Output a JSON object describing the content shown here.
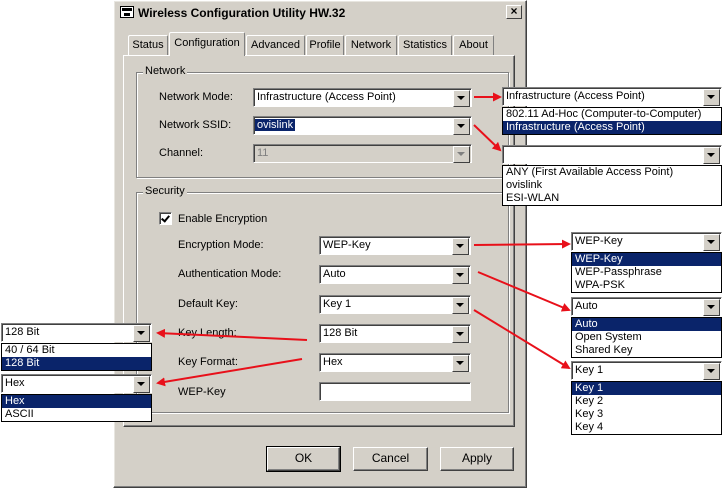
{
  "window": {
    "title": "Wireless Configuration Utility HW.32",
    "close": "×"
  },
  "tabs": [
    {
      "label": "Status"
    },
    {
      "label": "Configuration"
    },
    {
      "label": "Advanced"
    },
    {
      "label": "Profile"
    },
    {
      "label": "Network"
    },
    {
      "label": "Statistics"
    },
    {
      "label": "About"
    }
  ],
  "network_group": {
    "title": "Network",
    "mode_label": "Network Mode:",
    "mode_value": "Infrastructure (Access Point)",
    "ssid_label": "Network SSID:",
    "ssid_value": "ovislink",
    "channel_label": "Channel:",
    "channel_value": "11"
  },
  "security_group": {
    "title": "Security",
    "enable_label": "Enable Encryption",
    "enable_checked": true,
    "enc_mode_label": "Encryption Mode:",
    "enc_mode_value": "WEP-Key",
    "auth_mode_label": "Authentication Mode:",
    "auth_mode_value": "Auto",
    "default_key_label": "Default Key:",
    "default_key_value": "Key 1",
    "key_length_label": "Key Length:",
    "key_length_value": "128 Bit",
    "key_format_label": "Key Format:",
    "key_format_value": "Hex",
    "wep_key_label": "WEP-Key",
    "wep_key_value": ""
  },
  "buttons": {
    "ok": "OK",
    "cancel": "Cancel",
    "apply": "Apply"
  },
  "callouts": {
    "network_mode": {
      "current": "Infrastructure (Access Point)",
      "options": [
        "802.11 Ad-Hoc (Computer-to-Computer)",
        "Infrastructure (Access Point)"
      ],
      "selected": 1
    },
    "ssid": {
      "current": "",
      "options": [
        "ANY (First Available Access Point)",
        "ovislink",
        "ESI-WLAN"
      ],
      "selected": -1
    },
    "encryption": {
      "current": "WEP-Key",
      "options": [
        "WEP-Key",
        "WEP-Passphrase",
        "WPA-PSK"
      ],
      "selected": 0
    },
    "authentication": {
      "current": "Auto",
      "options": [
        "Auto",
        "Open System",
        "Shared Key"
      ],
      "selected": 0
    },
    "default_key": {
      "current": "Key 1",
      "options": [
        "Key 1",
        "Key 2",
        "Key 3",
        "Key 4"
      ],
      "selected": 0
    },
    "key_length": {
      "current": "128 Bit",
      "options": [
        "40 / 64 Bit",
        "128 Bit"
      ],
      "selected": 1
    },
    "key_format": {
      "current": "Hex",
      "options": [
        "Hex",
        "ASCII"
      ],
      "selected": 0
    }
  },
  "colors": {
    "window_bg": "#d4d0c8",
    "selection": "#0a246a",
    "arrow": "#e8101a"
  }
}
